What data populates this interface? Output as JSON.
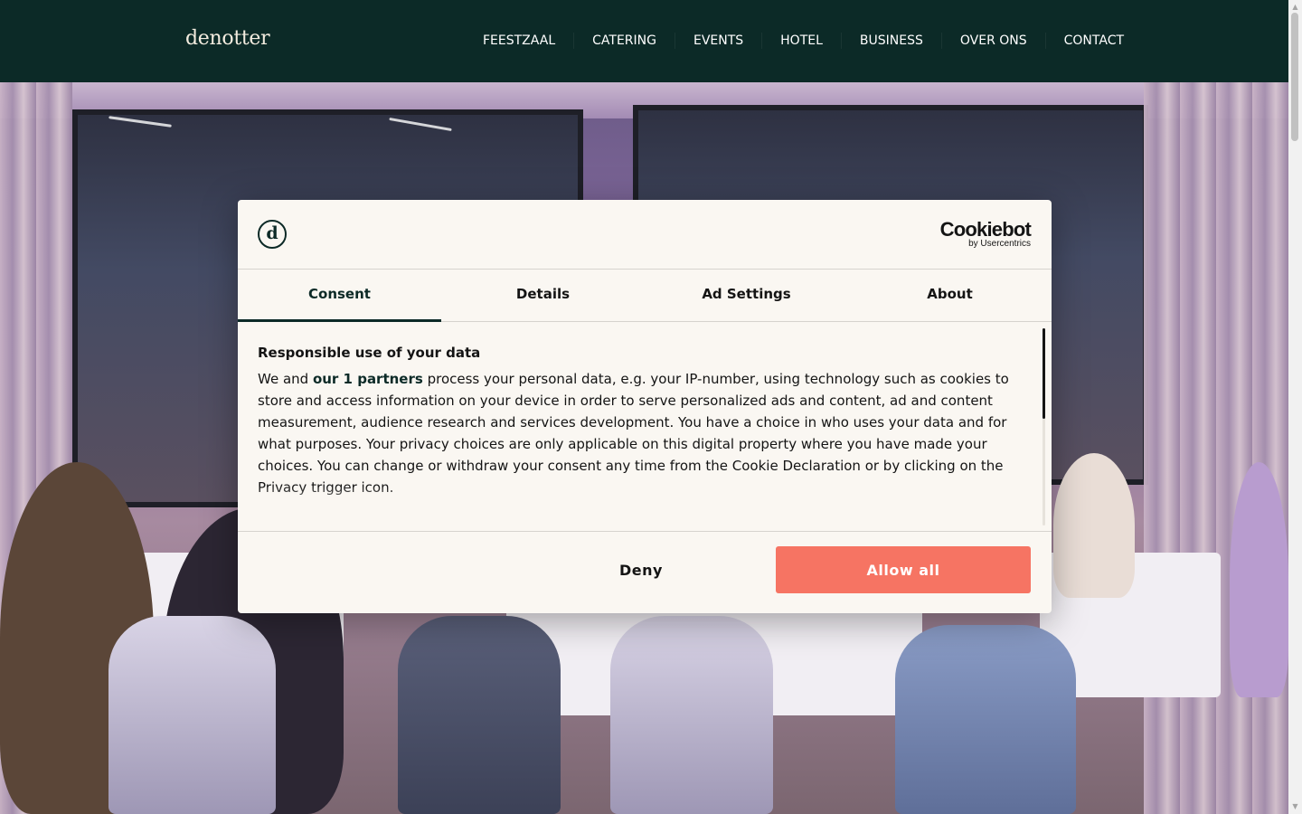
{
  "header": {
    "logo": "denotter",
    "nav": [
      "FEESTZAAL",
      "CATERING",
      "EVENTS",
      "HOTEL",
      "BUSINESS",
      "OVER ONS",
      "CONTACT"
    ]
  },
  "dialog": {
    "brand_mark": "d",
    "cookiebot_name": "Cookiebot",
    "cookiebot_sub": "by Usercentrics",
    "tabs": [
      {
        "label": "Consent",
        "active": true
      },
      {
        "label": "Details",
        "active": false
      },
      {
        "label": "Ad Settings",
        "active": false
      },
      {
        "label": "About",
        "active": false
      }
    ],
    "title": "Responsible use of your data",
    "body_prefix": "We and ",
    "partners_link": "our 1 partners",
    "body_suffix": " process your personal data, e.g. your IP-number, using technology such as cookies to store and access information on your device in order to serve personalized ads and content, ad and content measurement, audience research and services development. You have a choice in who uses your data and for what purposes. Your privacy choices are only applicable on this digital property where you have made your choices. You can change or withdraw your consent any time from the Cookie Declaration or by clicking on the Privacy trigger icon.",
    "deny_label": "Deny",
    "allow_label": "Allow all"
  },
  "colors": {
    "header_bg": "#0c2a27",
    "accent_button": "#f67463",
    "dialog_bg": "#faf7f2"
  }
}
